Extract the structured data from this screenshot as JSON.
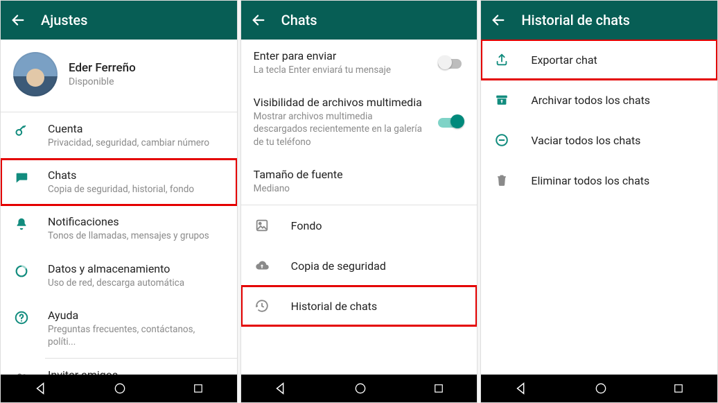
{
  "screen1": {
    "title": "Ajustes",
    "profile": {
      "name": "Eder Ferreño",
      "status": "Disponible"
    },
    "items": {
      "account": {
        "title": "Cuenta",
        "sub": "Privacidad, seguridad, cambiar número"
      },
      "chats": {
        "title": "Chats",
        "sub": "Copia de seguridad, historial, fondo"
      },
      "notif": {
        "title": "Notificaciones",
        "sub": "Tonos de llamadas, mensajes y grupos"
      },
      "data": {
        "title": "Datos y almacenamiento",
        "sub": "Uso de red, descarga automática"
      },
      "help": {
        "title": "Ayuda",
        "sub": "Preguntas frecuentes, contáctanos, políti..."
      },
      "invite": {
        "title": "Invitar amigos"
      }
    }
  },
  "screen2": {
    "title": "Chats",
    "enterToSend": {
      "title": "Enter para enviar",
      "sub": "La tecla Enter enviará tu mensaje",
      "on": false
    },
    "mediaVis": {
      "title": "Visibilidad de archivos multimedia",
      "sub": "Mostrar archivos multimedia descargados recientemente en la galería de tu teléfono",
      "on": true
    },
    "fontSize": {
      "title": "Tamaño de fuente",
      "sub": "Mediano"
    },
    "wallpaper": "Fondo",
    "backup": "Copia de seguridad",
    "history": "Historial de chats"
  },
  "screen3": {
    "title": "Historial de chats",
    "export": "Exportar chat",
    "archive": "Archivar todos los chats",
    "clear": "Vaciar todos los chats",
    "deleteAll": "Eliminar todos los chats"
  }
}
